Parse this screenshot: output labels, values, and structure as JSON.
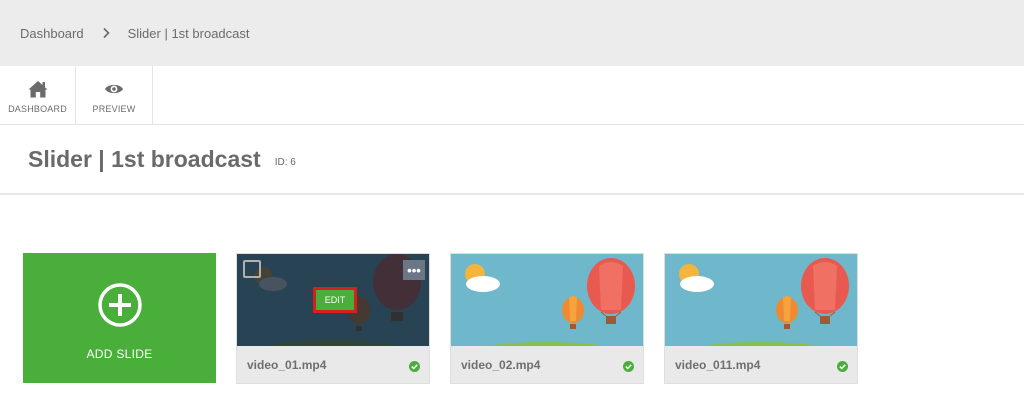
{
  "breadcrumb": {
    "items": [
      {
        "label": "Dashboard"
      },
      {
        "label": "Slider | 1st broadcast"
      }
    ]
  },
  "toolbar": {
    "items": [
      {
        "label": "DASHBOARD",
        "icon": "home-icon"
      },
      {
        "label": "PREVIEW",
        "icon": "eye-icon"
      }
    ]
  },
  "header": {
    "title": "Slider | 1st broadcast",
    "id_label": "ID: 6"
  },
  "slides": {
    "add_label": "ADD SLIDE",
    "edit_label": "EDIT",
    "more_label": "•••",
    "items": [
      {
        "filename": "video_01.mp4",
        "status": "ok"
      },
      {
        "filename": "video_02.mp4",
        "status": "ok"
      },
      {
        "filename": "video_011.mp4",
        "status": "ok"
      }
    ]
  },
  "colors": {
    "accent_green": "#4aae3a",
    "status_green": "#4aae3a",
    "edit_highlight": "#d32020",
    "sky_blue": "#6fb8cc"
  }
}
